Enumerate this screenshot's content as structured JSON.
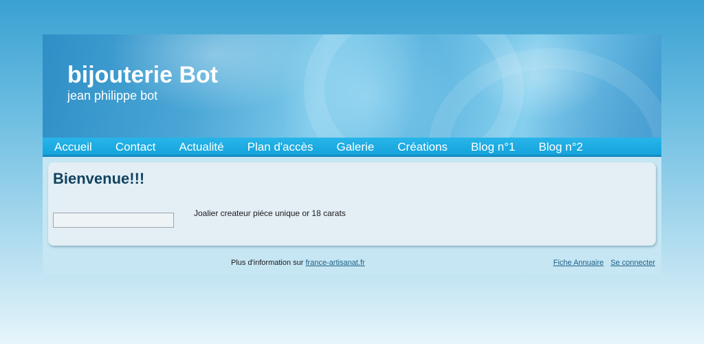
{
  "header": {
    "title": "bijouterie Bot",
    "subtitle": "jean philippe bot"
  },
  "nav": {
    "items": [
      {
        "label": "Accueil"
      },
      {
        "label": "Contact"
      },
      {
        "label": "Actualité"
      },
      {
        "label": "Plan d'accès"
      },
      {
        "label": "Galerie"
      },
      {
        "label": "Créations"
      },
      {
        "label": "Blog n°1"
      },
      {
        "label": "Blog n°2"
      }
    ]
  },
  "main": {
    "heading": "Bienvenue!!!",
    "description": "Joalier createur piéce unique or 18 carats"
  },
  "footer": {
    "info_prefix": "Plus d'information sur ",
    "info_link": "france-artisanat.fr",
    "annuaire_link": "Fiche Annuaire",
    "login_link": "Se connecter"
  },
  "colors": {
    "nav_bar": "#16a4dc",
    "heading": "#10435f",
    "link": "#1d5f86",
    "content_panel": "#e3eef5"
  }
}
